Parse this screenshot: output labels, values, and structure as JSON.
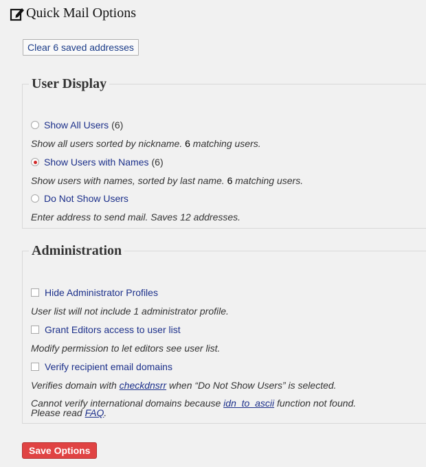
{
  "header": {
    "title": "Quick Mail Options",
    "icon": "edit-icon"
  },
  "clear_button": {
    "label": "Clear 6 saved addresses"
  },
  "user_display": {
    "legend": "User Display",
    "options": [
      {
        "label": "Show All Users",
        "count": "(6)",
        "checked": false,
        "desc_pre": "Show all users sorted by nickname. ",
        "desc_num": "6",
        "desc_post": " matching users."
      },
      {
        "label": "Show Users with Names",
        "count": "(6)",
        "checked": true,
        "desc_pre": "Show users with names, sorted by last name. ",
        "desc_num": "6",
        "desc_post": " matching users."
      },
      {
        "label": "Do Not Show Users",
        "count": "",
        "checked": false,
        "desc_pre": "Enter address to send mail. Saves 12 addresses.",
        "desc_num": "",
        "desc_post": ""
      }
    ]
  },
  "administration": {
    "legend": "Administration",
    "options": [
      {
        "label": "Hide Administrator Profiles",
        "checked": false,
        "desc": "User list will not include 1 administrator profile."
      },
      {
        "label": "Grant Editors access to user list",
        "checked": false,
        "desc": "Modify permission to let editors see user list."
      },
      {
        "label": "Verify recipient email domains",
        "checked": false,
        "desc_pre": "Verifies domain with ",
        "desc_link": "checkdnsrr",
        "desc_post": " when “Do Not Show Users” is selected."
      }
    ],
    "warning": {
      "pre": "Cannot verify international domains because ",
      "link": "idn_to_ascii",
      "mid": " function not found.",
      "line2_pre": "Please read ",
      "line2_link": "FAQ",
      "line2_post": "."
    }
  },
  "save_button": {
    "label": "Save Options"
  },
  "colors": {
    "accent_red": "#e04343",
    "link_blue": "#1b2f8a",
    "radio_selected": "#d12a2a"
  }
}
